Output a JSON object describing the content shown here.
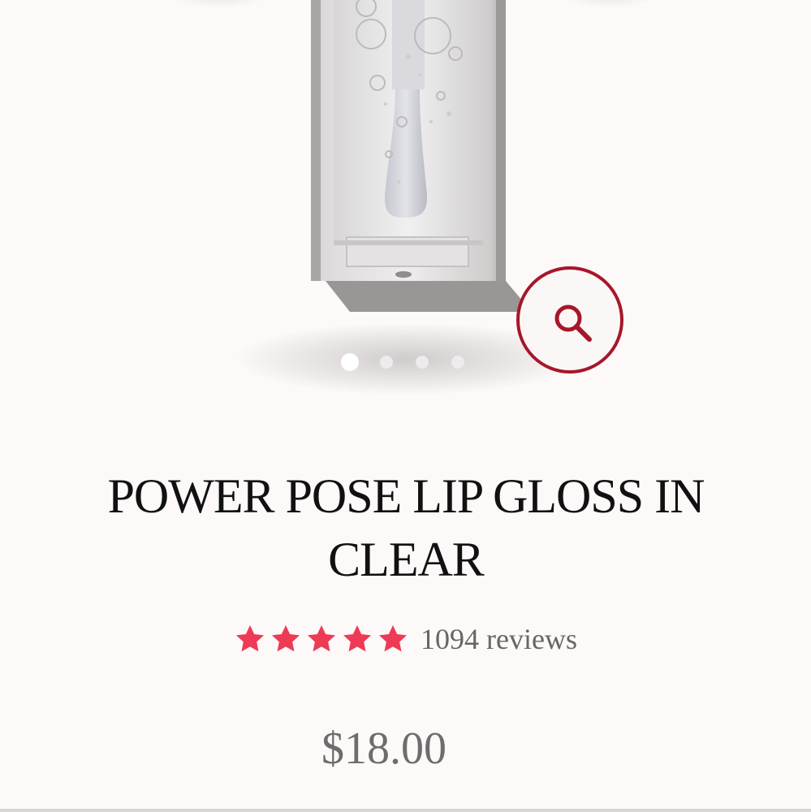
{
  "product": {
    "title": "POWER POSE LIP GLOSS IN CLEAR",
    "rating": 5,
    "max_rating": 5,
    "reviews_label": "1094 reviews",
    "price": "$18.00"
  },
  "gallery": {
    "slide_count": 4,
    "active_slide": 1,
    "zoom_icon": "search-icon"
  },
  "colors": {
    "accent": "#a6172a",
    "star": "#ee3a55",
    "background": "#fcf9f8"
  }
}
